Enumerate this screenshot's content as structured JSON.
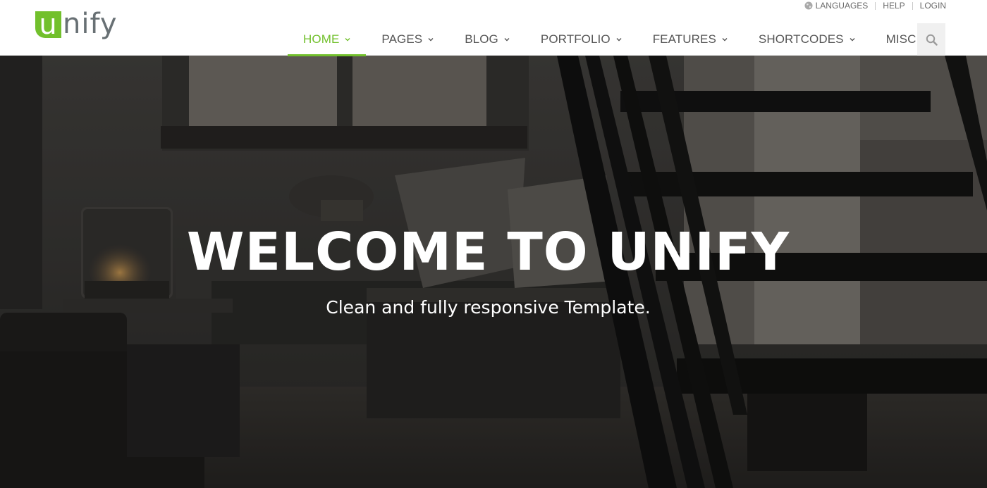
{
  "brand": {
    "logo_letter": "u",
    "logo_rest": "nify",
    "accent": "#72c02c"
  },
  "topbar": {
    "items": [
      {
        "label": "LANGUAGES",
        "icon": "globe-icon"
      },
      {
        "label": "HELP"
      },
      {
        "label": "LOGIN"
      }
    ]
  },
  "nav": {
    "items": [
      {
        "label": "HOME",
        "active": true
      },
      {
        "label": "PAGES"
      },
      {
        "label": "BLOG"
      },
      {
        "label": "PORTFOLIO"
      },
      {
        "label": "FEATURES"
      },
      {
        "label": "SHORTCODES"
      },
      {
        "label": "MISC"
      }
    ],
    "search_icon": "search-icon"
  },
  "hero": {
    "title": "WELCOME TO UNIFY",
    "subtitle": "Clean and fully responsive Template."
  }
}
